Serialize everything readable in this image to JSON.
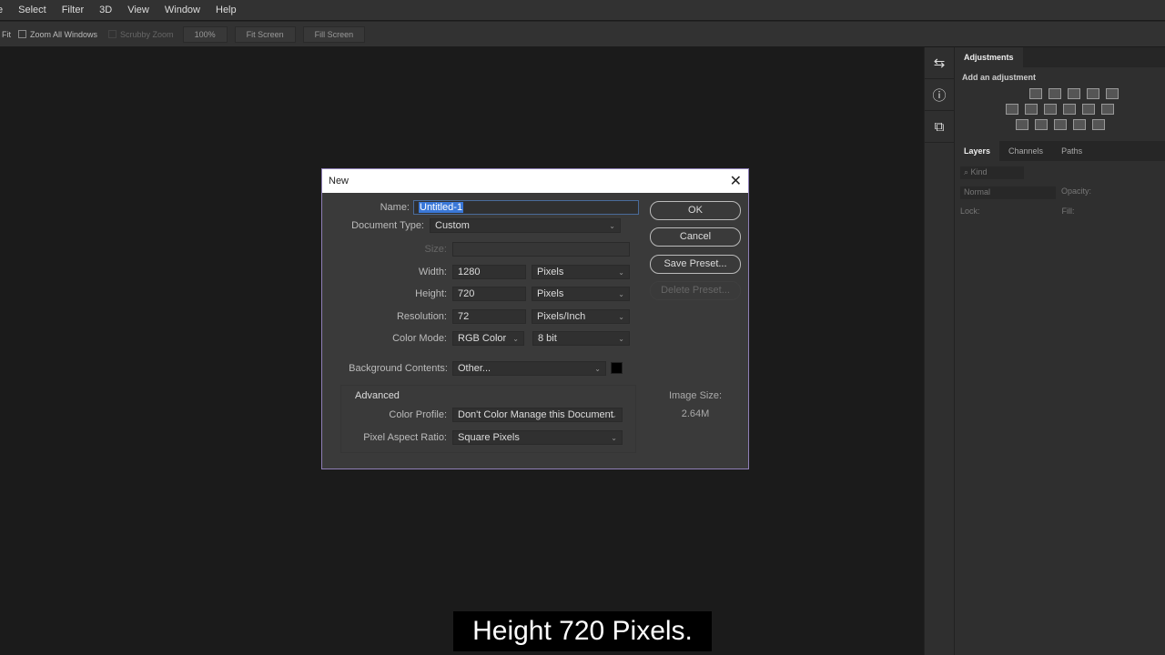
{
  "menubar": {
    "items": [
      "e",
      "Select",
      "Filter",
      "3D",
      "View",
      "Window",
      "Help"
    ]
  },
  "optbar": {
    "fit": "Fit",
    "zoom_all": "Zoom All Windows",
    "scrubby": "Scrubby Zoom",
    "zoom_pct": "100%",
    "fit_screen": "Fit Screen",
    "fill_screen": "Fill Screen"
  },
  "panel": {
    "adjustments_tab": "Adjustments",
    "add_adjustment": "Add an adjustment",
    "layers_tabs": [
      "Layers",
      "Channels",
      "Paths"
    ],
    "kind": "Kind",
    "blend": "Normal",
    "opacity": "Opacity:",
    "lock": "Lock:",
    "fill": "Fill:"
  },
  "dialog": {
    "title": "New",
    "name_label": "Name:",
    "name_value": "Untitled-1",
    "doctype_label": "Document Type:",
    "doctype_value": "Custom",
    "size_label": "Size:",
    "width_label": "Width:",
    "width_value": "1280",
    "width_unit": "Pixels",
    "height_label": "Height:",
    "height_value": "720",
    "height_unit": "Pixels",
    "res_label": "Resolution:",
    "res_value": "72",
    "res_unit": "Pixels/Inch",
    "mode_label": "Color Mode:",
    "mode_value": "RGB Color",
    "bit_value": "8 bit",
    "bg_label": "Background Contents:",
    "bg_value": "Other...",
    "bg_color": "#000000",
    "advanced": "Advanced",
    "profile_label": "Color Profile:",
    "profile_value": "Don't Color Manage this Document",
    "par_label": "Pixel Aspect Ratio:",
    "par_value": "Square Pixels",
    "ok": "OK",
    "cancel": "Cancel",
    "save_preset": "Save Preset...",
    "delete_preset": "Delete Preset...",
    "image_size_label": "Image Size:",
    "image_size_value": "2.64M"
  },
  "caption": "Height 720 Pixels."
}
